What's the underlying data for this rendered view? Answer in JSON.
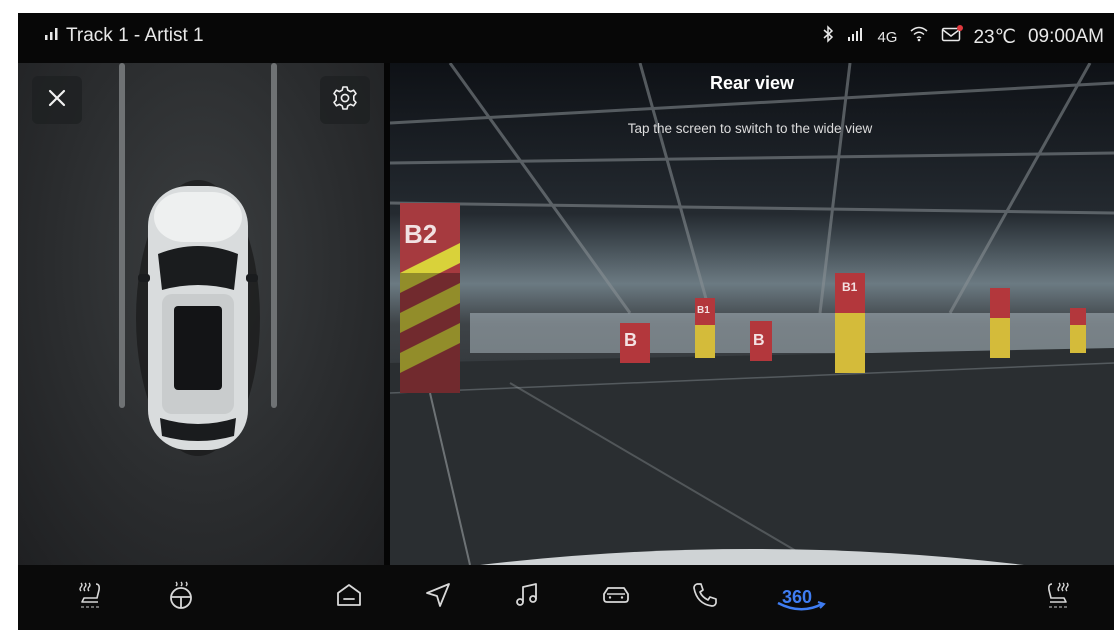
{
  "status_bar": {
    "media": "Track 1 - Artist 1",
    "network": "4G",
    "temperature": "23℃",
    "time": "09:00AM",
    "icons": [
      "signal-bars-icon",
      "bluetooth-icon",
      "cell-signal-icon",
      "wifi-icon",
      "message-icon"
    ]
  },
  "left_panel": {
    "close_icon": "close-icon",
    "settings_icon": "gear-icon"
  },
  "rear_view": {
    "title": "Rear view",
    "hint": "Tap the screen to switch to the wide view",
    "pillar_labels": [
      "B2",
      "B1",
      "B",
      "B",
      "B1"
    ]
  },
  "dock": {
    "items": [
      {
        "name": "seat-heat-left-icon"
      },
      {
        "name": "steering-wheel-heat-icon"
      },
      {
        "name": "home-icon"
      },
      {
        "name": "navigation-icon"
      },
      {
        "name": "music-icon"
      },
      {
        "name": "car-icon"
      },
      {
        "name": "phone-icon"
      },
      {
        "name": "camera-360-icon",
        "label": "360",
        "active": true
      },
      {
        "name": "seat-heat-right-icon"
      }
    ]
  },
  "colors": {
    "accent": "#3f7df2",
    "background": "#050505",
    "alert": "#e0393e"
  }
}
